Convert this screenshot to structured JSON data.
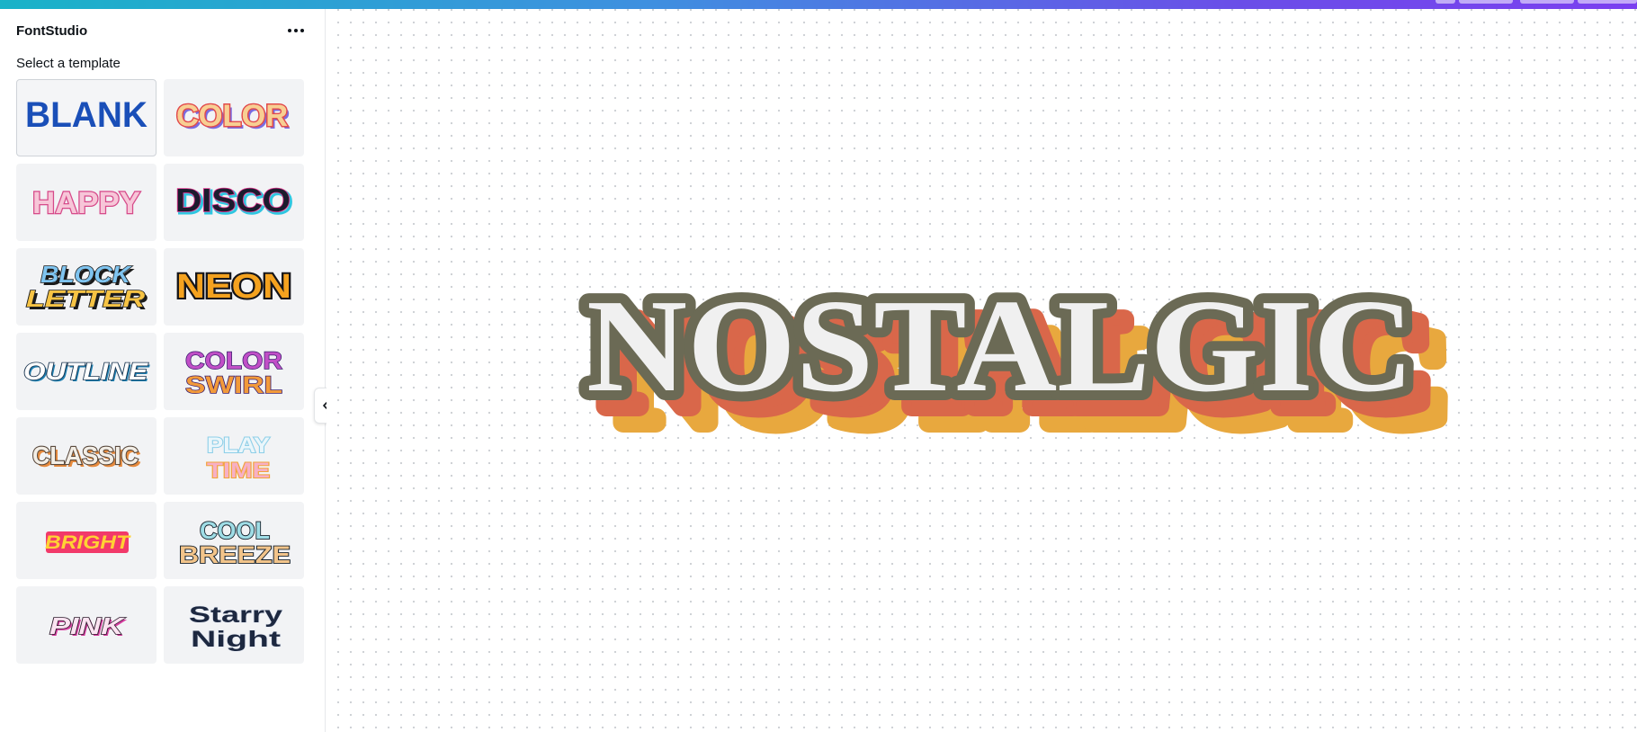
{
  "app": {
    "title": "FontStudio",
    "more_icon": "more-horizontal-icon"
  },
  "panel": {
    "section_label": "Select a template",
    "collapse_icon": "chevron-left-icon"
  },
  "templates": [
    {
      "label": "BLANK",
      "selected": true
    },
    {
      "label": "COLOR"
    },
    {
      "label": "HAPPY"
    },
    {
      "label": "DISCO"
    },
    {
      "label": "BLOCK LETTER"
    },
    {
      "label": "NEON"
    },
    {
      "label": "OUTLINE"
    },
    {
      "label": "COLOR SWIRL"
    },
    {
      "label": "CLASSIC"
    },
    {
      "label": "PLAY TIME"
    },
    {
      "label": "BRIGHT"
    },
    {
      "label": "COOL BREEZE"
    },
    {
      "label": "PINK"
    },
    {
      "label": "Starry Night"
    }
  ],
  "preview": {
    "text": "NOSTALGIC",
    "colors": {
      "face": "#f0f0f0",
      "outline": "#6b6a55",
      "shadow_1": "#d9674a",
      "shadow_2": "#e8a83e"
    }
  },
  "colors": {
    "accent_gradient_start": "#19b3c8",
    "accent_gradient_end": "#7b3ff0",
    "panel_bg": "#ffffff",
    "tile_bg": "#f2f3f5",
    "text": "#0e1318"
  }
}
